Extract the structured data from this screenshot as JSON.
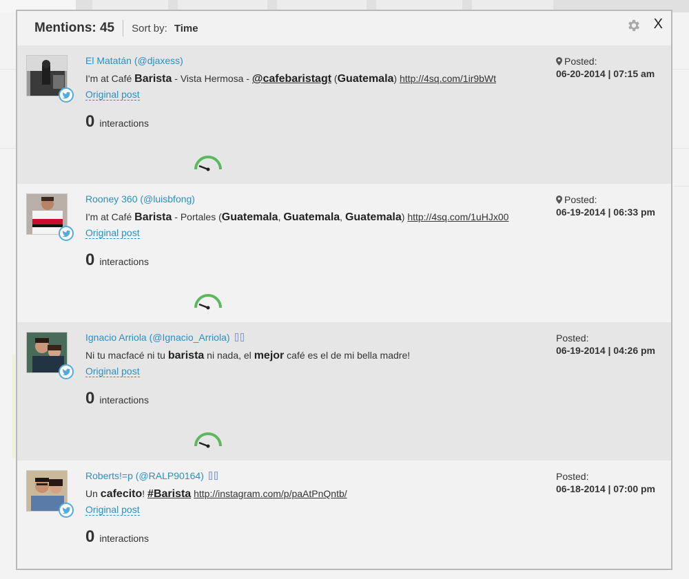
{
  "header": {
    "mentions_label": "Mentions: 45",
    "sort_label": "Sort by:",
    "sort_value": "Time",
    "close_label": "X"
  },
  "mentions": [
    {
      "author": "El Matatán (@djaxess)",
      "text_parts": [
        "I'm at Café ",
        "Barista",
        " - Vista Hermosa - ",
        "@cafebaristagt",
        " (",
        "Guatemala",
        ") ",
        "http://4sq.com/1ir9bWt"
      ],
      "original_post": "Original post",
      "interactions_count": "0",
      "interactions_label": "interactions",
      "posted_label": "Posted:",
      "posted_date": "06-20-2014 | 07:15 am",
      "has_pin": true
    },
    {
      "author": "Rooney 360 (@luisbfong)",
      "text_parts": [
        "I'm at Café ",
        "Barista",
        " - Portales (",
        "Guatemala",
        ", ",
        "Guatemala",
        ", ",
        "Guatemala",
        ") ",
        "http://4sq.com/1uHJx00"
      ],
      "original_post": "Original post",
      "interactions_count": "0",
      "interactions_label": "interactions",
      "posted_label": "Posted:",
      "posted_date": "06-19-2014 | 06:33 pm",
      "has_pin": true
    },
    {
      "author": "Ignacio Arriola (@Ignacio_Arriola)",
      "text_parts": [
        "Ni tu macfacé ni tu ",
        "barista",
        " ni nada, el ",
        "mejor",
        " café es el de mi bella madre!"
      ],
      "original_post": "Original post",
      "interactions_count": "0",
      "interactions_label": "interactions",
      "posted_label": "Posted:",
      "posted_date": "06-19-2014 | 04:26 pm",
      "has_pin": false
    },
    {
      "author": "Roberts!=p (@RALP90164)",
      "text_parts": [
        "Un ",
        "cafecito",
        "! ",
        "#Barista",
        " ",
        "http://instagram.com/p/paAtPnQntb/"
      ],
      "original_post": "Original post",
      "interactions_count": "0",
      "interactions_label": "interactions",
      "posted_label": "Posted:",
      "posted_date": "06-18-2014 | 07:00 pm",
      "has_pin": false
    }
  ],
  "colors": {
    "link_blue": "#2a8fc5",
    "twitter_blue": "#55a9dc",
    "gauge_green": "#5cb85c"
  },
  "icons": [
    "settings-gear-icon",
    "close-icon",
    "twitter-icon",
    "location-pin-icon",
    "sentiment-gauge-icon"
  ]
}
